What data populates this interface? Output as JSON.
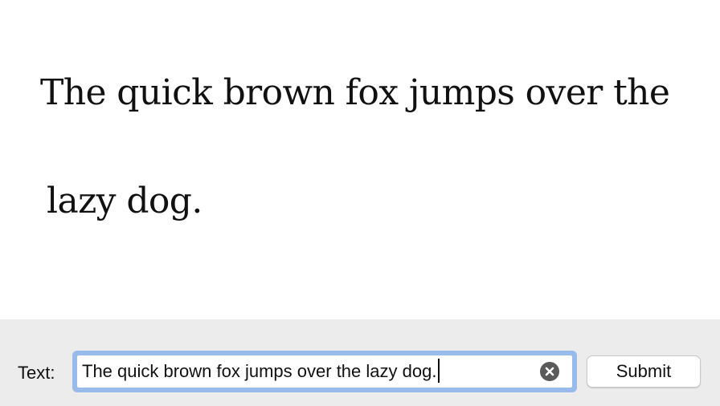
{
  "display": {
    "line1": "The quick brown fox jumps over the",
    "line2": "lazy dog."
  },
  "form": {
    "label": "Text:",
    "input_value": "The quick brown fox jumps over the lazy dog.",
    "clear_icon": "clear-icon",
    "submit_label": "Submit"
  },
  "colors": {
    "bar_background": "#ececec",
    "focus_ring": "#99bbec",
    "clear_icon": "#5a5a5a"
  }
}
